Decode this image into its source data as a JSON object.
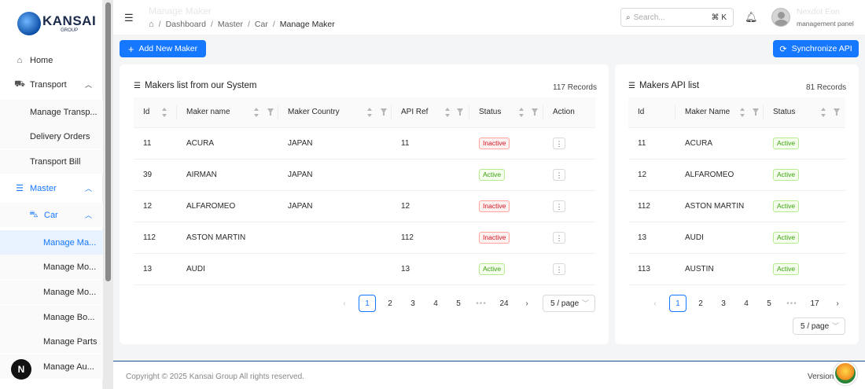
{
  "brand": {
    "name": "KANSAI",
    "sub": "GROUP"
  },
  "sidebar": {
    "items": [
      {
        "label": "Home",
        "icon": "home-icon",
        "level": 0
      },
      {
        "label": "Transport",
        "icon": "truck-icon",
        "level": 0,
        "expanded": true
      },
      {
        "label": "Manage Transp...",
        "level": 1
      },
      {
        "label": "Delivery Orders",
        "level": 1
      },
      {
        "label": "Transport Bill",
        "level": 1
      },
      {
        "label": "Master",
        "icon": "database-icon",
        "level": 0,
        "expanded": true
      },
      {
        "label": "Car",
        "icon": "car-icon",
        "level": 1,
        "expanded": true
      },
      {
        "label": "Manage Ma...",
        "level": 2,
        "active": true
      },
      {
        "label": "Manage Mo...",
        "level": 2
      },
      {
        "label": "Manage Mo...",
        "level": 2
      },
      {
        "label": "Manage Bo...",
        "level": 2
      },
      {
        "label": "Manage Parts",
        "level": 2
      },
      {
        "label": "Manage Au...",
        "level": 2
      }
    ],
    "badge": "N"
  },
  "topbar": {
    "title": "Manage Maker",
    "breadcrumb": [
      "Dashboard",
      "Master",
      "Car",
      "Manage Maker"
    ],
    "search_placeholder": "Search...",
    "search_shortcut": "⌘ K",
    "user_name": "Nexdot Eon",
    "user_role": "management panel"
  },
  "actions": {
    "add_label": "Add New Maker",
    "sync_label": "Synchronize API"
  },
  "system_table": {
    "title": "Makers list from our System",
    "records": "117 Records",
    "columns": [
      "Id",
      "Maker name",
      "Maker Country",
      "API Ref",
      "Status",
      "Action"
    ],
    "rows": [
      {
        "id": "11",
        "name": "ACURA",
        "country": "JAPAN",
        "api_ref": "11",
        "status": "Inactive"
      },
      {
        "id": "39",
        "name": "AIRMAN",
        "country": "JAPAN",
        "api_ref": "",
        "status": "Active"
      },
      {
        "id": "12",
        "name": "ALFAROMEO",
        "country": "JAPAN",
        "api_ref": "12",
        "status": "Inactive"
      },
      {
        "id": "112",
        "name": "ASTON MARTIN",
        "country": "",
        "api_ref": "112",
        "status": "Inactive"
      },
      {
        "id": "13",
        "name": "AUDI",
        "country": "",
        "api_ref": "13",
        "status": "Active"
      }
    ],
    "action_glyph": "⋮",
    "pagination": {
      "prev": "‹",
      "next": "›",
      "pages": [
        "1",
        "2",
        "3",
        "4",
        "5"
      ],
      "ellipsis": "•••",
      "last": "24",
      "page_size": "5 / page"
    }
  },
  "api_table": {
    "title": "Makers API list",
    "records": "81 Records",
    "columns": [
      "Id",
      "Maker Name",
      "Status"
    ],
    "rows": [
      {
        "id": "11",
        "name": "ACURA",
        "status": "Active"
      },
      {
        "id": "12",
        "name": "ALFAROMEO",
        "status": "Active"
      },
      {
        "id": "112",
        "name": "ASTON MARTIN",
        "status": "Active"
      },
      {
        "id": "13",
        "name": "AUDI",
        "status": "Active"
      },
      {
        "id": "113",
        "name": "AUSTIN",
        "status": "Active"
      }
    ],
    "pagination": {
      "prev": "‹",
      "next": "›",
      "pages": [
        "1",
        "2",
        "3",
        "4",
        "5"
      ],
      "ellipsis": "•••",
      "last": "17",
      "page_size": "5 / page"
    }
  },
  "footer": {
    "copyright": "Copyright © 2025 Kansai Group All rights reserved.",
    "version": "Version"
  },
  "colors": {
    "primary": "#1677ff",
    "inactive": "#cf1322",
    "active": "#389e0d"
  }
}
